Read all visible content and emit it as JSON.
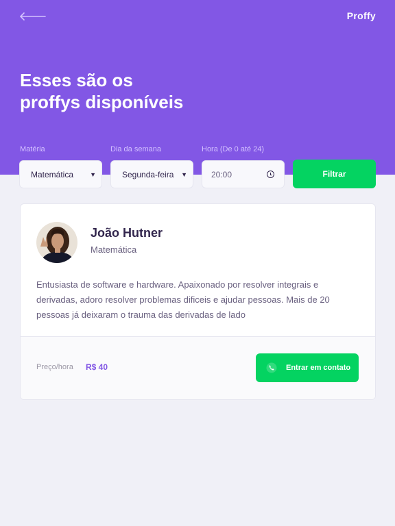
{
  "header": {
    "logo": "Proffy",
    "title_line1": "Esses são os",
    "title_line2": "proffys disponíveis",
    "back_icon": "arrow-left-icon"
  },
  "filters": {
    "subject": {
      "label": "Matéria",
      "value": "Matemática"
    },
    "weekday": {
      "label": "Dia da semana",
      "value": "Segunda-feira"
    },
    "time": {
      "label": "Hora (De 0 até 24)",
      "value": "20:00"
    },
    "submit_label": "Filtrar"
  },
  "teacher": {
    "name": "João Hutner",
    "subject": "Matemática",
    "bio": "Entusiasta de software e hardware. Apaixonado por resolver integrais e derivadas, adoro resolver problemas dificeis e ajudar pessoas. Mais de 20 pessoas já deixaram o trauma das derivadas de lado",
    "price_label": "Preço/hora",
    "price_value": "R$ 40",
    "contact_label": "Entrar em contato",
    "contact_icon": "whatsapp-icon"
  },
  "colors": {
    "primary": "#8257E5",
    "secondary": "#04D361",
    "background": "#F0F0F7",
    "text_title": "#32264D",
    "text_base": "#6A6180"
  }
}
